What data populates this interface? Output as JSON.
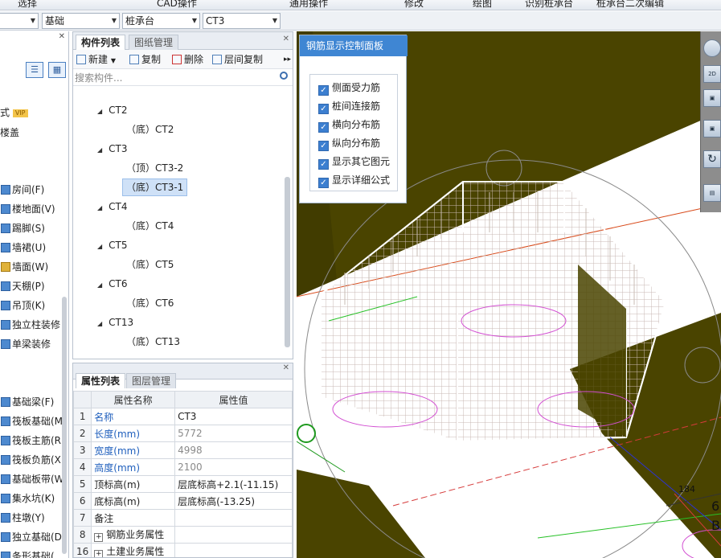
{
  "menu": [
    "选择",
    "CAD操作",
    "通用操作",
    "修改",
    "绘图",
    "识别桩承台",
    "桩承台二次编辑"
  ],
  "selectors": [
    {
      "value": ""
    },
    {
      "value": "基础"
    },
    {
      "value": "桩承台"
    },
    {
      "value": "CT3"
    }
  ],
  "left_nav": {
    "items_top": [
      {
        "label": "式",
        "badge": "VIP"
      },
      {
        "label": "楼盖"
      }
    ],
    "items": [
      "房间(F)",
      "楼地面(V)",
      "踢脚(S)",
      "墙裙(U)",
      "墙面(W)",
      "天棚(P)",
      "吊顶(K)",
      "独立柱装修",
      "单梁装修"
    ],
    "items2": [
      "基础梁(F)",
      "筏板基础(M",
      "筏板主筋(R",
      "筏板负筋(X",
      "基础板带(W",
      "集水坑(K)",
      "柱墩(Y)",
      "独立基础(D",
      "条形基础("
    ]
  },
  "component_panel": {
    "tabs": [
      "构件列表",
      "图纸管理"
    ],
    "toolbar": {
      "new": "新建",
      "copy": "复制",
      "delete": "删除",
      "floor_copy": "层间复制"
    },
    "search_placeholder": "搜索构件...",
    "tree": [
      {
        "group": "CT2",
        "children": [
          "（底）CT2"
        ]
      },
      {
        "group": "CT3",
        "children": [
          "（顶）CT3-2",
          "（底）CT3-1"
        ]
      },
      {
        "group": "CT4",
        "children": [
          "（底）CT4"
        ]
      },
      {
        "group": "CT5",
        "children": [
          "（底）CT5"
        ]
      },
      {
        "group": "CT6",
        "children": [
          "（底）CT6"
        ]
      },
      {
        "group": "CT13",
        "children": [
          "（底）CT13"
        ]
      }
    ],
    "selected": "（底）CT3-1"
  },
  "property_panel": {
    "tabs": [
      "属性列表",
      "图层管理"
    ],
    "headers": [
      "属性名称",
      "属性值"
    ],
    "rows": [
      {
        "n": "1",
        "name": "名称",
        "value": "CT3"
      },
      {
        "n": "2",
        "name": "长度(mm)",
        "value": "5772"
      },
      {
        "n": "3",
        "name": "宽度(mm)",
        "value": "4998"
      },
      {
        "n": "4",
        "name": "高度(mm)",
        "value": "2100"
      },
      {
        "n": "5",
        "name": "顶标高(m)",
        "value": "层底标高+2.1(-11.15)"
      },
      {
        "n": "6",
        "name": "底标高(m)",
        "value": "层底标高(-13.25)"
      },
      {
        "n": "7",
        "name": "备注",
        "value": ""
      },
      {
        "n": "8",
        "name": "钢筋业务属性",
        "value": ""
      },
      {
        "n": "16",
        "name": "土建业务属性",
        "value": ""
      }
    ]
  },
  "rebar_panel": {
    "title": "钢筋显示控制面板",
    "options": [
      "侧面受力筋",
      "桩间连接筋",
      "横向分布筋",
      "纵向分布筋",
      "显示其它图元",
      "显示详细公式"
    ]
  },
  "viewport": {
    "labels": {
      "dim1": "184",
      "side1": "6",
      "side2": "B"
    },
    "view_button": "2D"
  },
  "colors": {
    "accent": "#3f86d3",
    "floor": "#4a4400",
    "selected": "#cfe1f7"
  }
}
